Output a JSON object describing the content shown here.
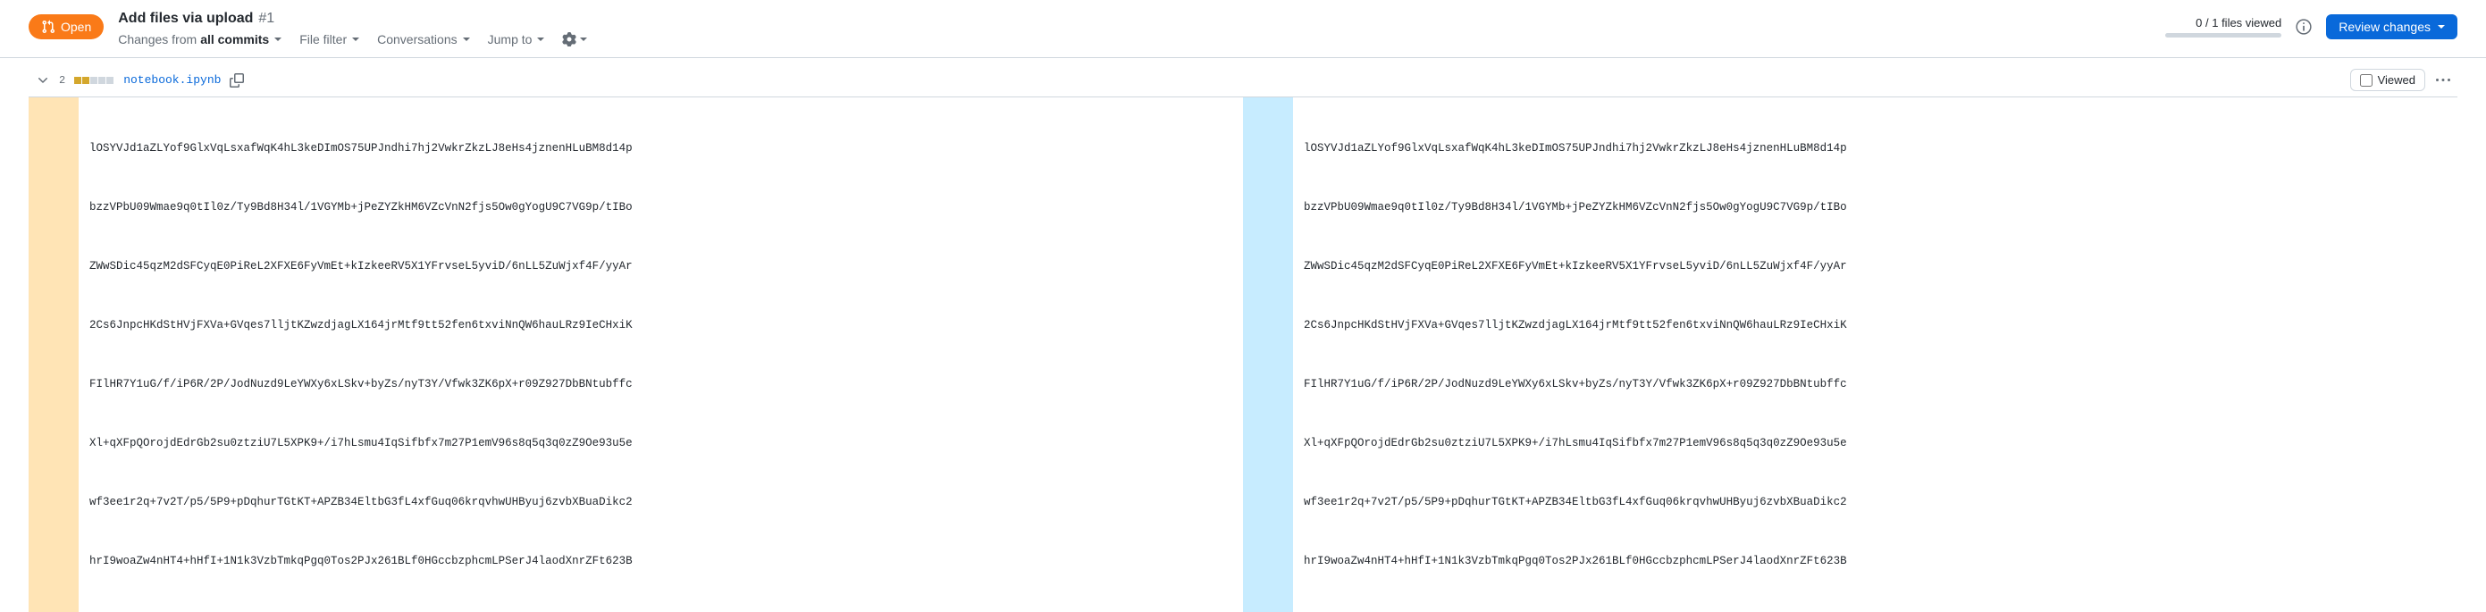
{
  "state": {
    "label": "Open"
  },
  "pr": {
    "title": "Add files via upload",
    "number": "#1"
  },
  "toolbar": {
    "changes_prefix": "Changes from ",
    "changes_bold": "all commits",
    "file_filter": "File filter",
    "conversations": "Conversations",
    "jump_to": "Jump to"
  },
  "summary": {
    "files_viewed": "0 / 1 files viewed"
  },
  "review": {
    "button": "Review changes"
  },
  "file": {
    "chevron_dir": "down",
    "diff_count": "2",
    "name": "notebook.ipynb",
    "viewed_label": "Viewed"
  },
  "diff": {
    "lines": [
      "lOSYVJd1aZLYof9GlxVqLsxafWqK4hL3keDImOS75UPJndhi7hj2VwkrZkzLJ8eHs4jznenHLuBM8d14p",
      "bzzVPbU09Wmae9q0tIl0z/Ty9Bd8H34l/1VGYMb+jPeZYZkHM6VZcVnN2fjs5Ow0gYogU9C7VG9p/tIBo",
      "ZWwSDic45qzM2dSFCyqE0PiReL2XFXE6FyVmEt+kIzkeeRV5X1YFrvseL5yviD/6nLL5ZuWjxf4F/yyAr",
      "2Cs6JnpcHKdStHVjFXVa+GVqes7lljtKZwzdjagLX164jrMtf9tt52fen6txviNnQW6hauLRz9IeCHxiK",
      "FIlHR7Y1uG/f/iP6R/2P/JodNuzd9LeYWXy6xLSkv+byZs/nyT3Y/Vfwk3ZK6pX+r09Z927DbBNtubffc",
      "Xl+qXFpQOrojdEdrGb2su0ztziU7L5XPK9+/i7hLsmu4IqSifbfx7m27P1emV96s8q5q3q0zZ9Oe93u5e",
      "wf3ee1r2q+7v2T/p5/5P9+pDqhurTGtKT+APZB34EltbG3fL4xfGuq06krqvhwUHByuj6zvbXBuaDikc2",
      "hrI9woaZw4nHT4+hHfI+1N1k3VzbTmkqPgq0Tos2PJx261BLf0HGccbzphcmLPSerJ4laodXnrZFt623B"
    ]
  }
}
